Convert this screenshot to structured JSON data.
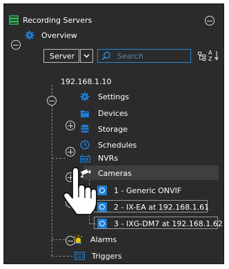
{
  "header": {
    "title": "Recording Servers"
  },
  "overview": {
    "label": "Overview"
  },
  "toolbar": {
    "server_label": "Server",
    "search_placeholder": "Search",
    "sort_label": "A Z"
  },
  "tree": {
    "server_name": "192.168.1.10",
    "items": {
      "settings": "Settings",
      "devices": "Devices",
      "storage": "Storage",
      "schedules": "Schedules",
      "nvrs": "NVRs",
      "cameras": "Cameras",
      "alarms": "Alarms",
      "triggers": "Triggers"
    },
    "cameras": [
      {
        "label": "1 - Generic ONVIF"
      },
      {
        "label": "2 - IX-EA at 192.168.1.61"
      },
      {
        "label": "3 - IXG-DM7 at 192.168.1.62"
      }
    ]
  },
  "colors": {
    "panel_bg": "#2b2b2b",
    "accent_blue": "#1f7fd8",
    "server_green": "#2ecc5a",
    "alarm_yellow": "#f2c200"
  }
}
